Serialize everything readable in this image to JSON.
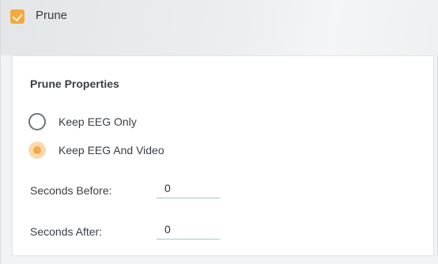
{
  "window": {
    "title": "Prune",
    "icon": "prune-app-icon",
    "accent_color": "#f3a93c"
  },
  "panel": {
    "title": "Prune Properties",
    "options": [
      {
        "label": "Keep EEG Only",
        "checked": false
      },
      {
        "label": "Keep EEG And Video",
        "checked": true
      }
    ],
    "fields": {
      "seconds_before": {
        "label": "Seconds Before:",
        "value": "0"
      },
      "seconds_after": {
        "label": "Seconds After:",
        "value": "0"
      }
    }
  }
}
